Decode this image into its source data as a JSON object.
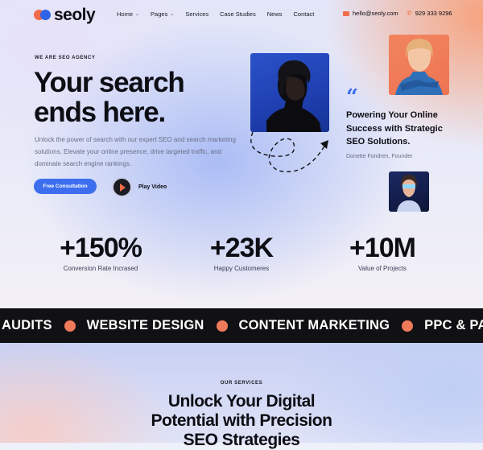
{
  "brand": {
    "name": "seoly"
  },
  "nav": {
    "items": [
      {
        "label": "Home",
        "dropdown": true
      },
      {
        "label": "Pages",
        "dropdown": true
      },
      {
        "label": "Services",
        "dropdown": false
      },
      {
        "label": "Case Studies",
        "dropdown": false
      },
      {
        "label": "News",
        "dropdown": false
      },
      {
        "label": "Contact",
        "dropdown": false
      }
    ]
  },
  "contact": {
    "email": "hello@seoly.com",
    "phone": "929 333 9296"
  },
  "hero": {
    "eyebrow": "WE ARE SEO AGENCY",
    "title_line1": "Your search",
    "title_line2": "ends here.",
    "description": "Unlock the power of search with our expert SEO and search marketing solutions. Elevate your online presence, drive targeted traffic, and dominate search engine rankings.",
    "cta_label": "Free Consultation",
    "video_label": "Play Video"
  },
  "testimonial": {
    "quote": "Powering Your Online Success with Strategic SEO Solutions.",
    "author": "Donette Fondren, Founder"
  },
  "stats": [
    {
      "value": "+150%",
      "label": "Conversion Rate Incrased"
    },
    {
      "value": "+23K",
      "label": "Happy Customeres"
    },
    {
      "value": "+10M",
      "label": "Value of Projects"
    }
  ],
  "ticker": [
    "L & AUDITS",
    "WEBSITE DESIGN",
    "CONTENT MARKETING",
    "PPC & PAID"
  ],
  "services": {
    "eyebrow": "OUR SERVICES",
    "title_line1": "Unlock Your Digital",
    "title_line2": "Potential with Precision",
    "title_line3": "SEO Strategies"
  },
  "colors": {
    "accent": "#3d6ef0",
    "brand_orange": "#ef6b4a",
    "dark": "#111114"
  }
}
